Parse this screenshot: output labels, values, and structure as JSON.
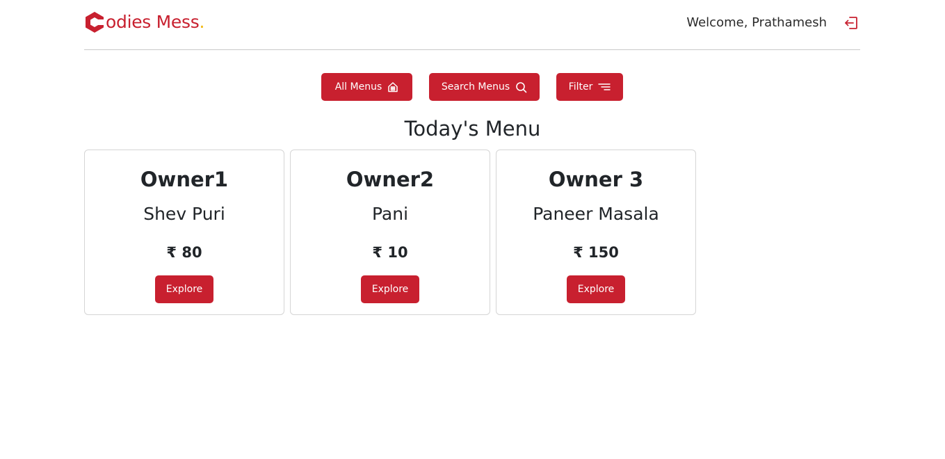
{
  "brand": {
    "logo_letter": "C",
    "name": "odies Mess",
    "dot": ".",
    "accent": "#c8202f",
    "dot_color": "#f2b705"
  },
  "header": {
    "welcome": "Welcome, Prathamesh",
    "logout_icon": "logout-icon"
  },
  "actions": {
    "all_menus": {
      "label": "All Menus",
      "icon": "home-icon"
    },
    "search_menus": {
      "label": "Search Menus",
      "icon": "search-icon"
    },
    "filter": {
      "label": "Filter",
      "icon": "filter-icon"
    }
  },
  "page_title": "Today's Menu",
  "cards": [
    {
      "owner": "Owner1",
      "dish": "Shev Puri",
      "price": "₹ 80",
      "button": "Explore"
    },
    {
      "owner": "Owner2",
      "dish": "Pani",
      "price": "₹ 10",
      "button": "Explore"
    },
    {
      "owner": "Owner 3",
      "dish": "Paneer Masala",
      "price": "₹ 150",
      "button": "Explore"
    }
  ]
}
